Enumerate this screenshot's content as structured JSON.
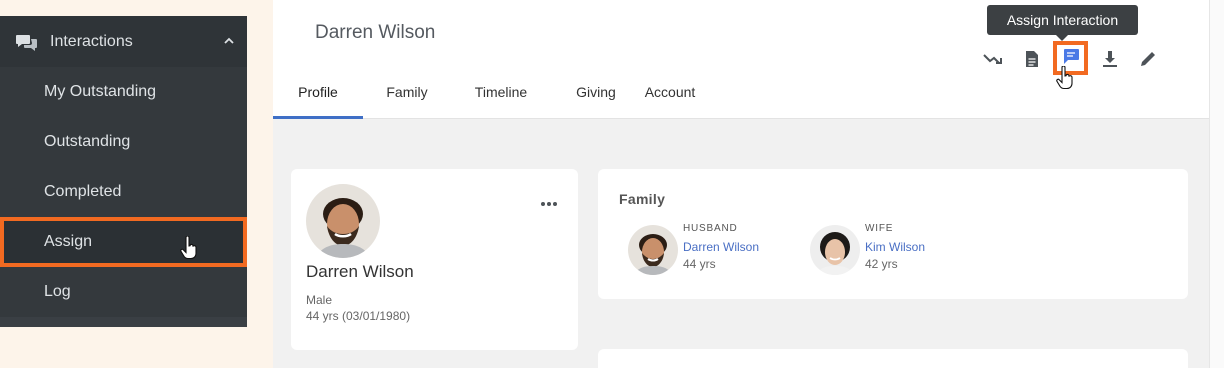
{
  "sidebar": {
    "header_label": "Interactions",
    "items": [
      {
        "label": "My Outstanding"
      },
      {
        "label": "Outstanding"
      },
      {
        "label": "Completed"
      },
      {
        "label": "Assign"
      },
      {
        "label": "Log"
      }
    ]
  },
  "header": {
    "person_name": "Darren Wilson"
  },
  "tabs": [
    {
      "label": "Profile",
      "active": true
    },
    {
      "label": "Family"
    },
    {
      "label": "Timeline"
    },
    {
      "label": "Giving"
    },
    {
      "label": "Account"
    }
  ],
  "actions": [
    {
      "icon": "share-arrow-icon"
    },
    {
      "icon": "document-icon"
    },
    {
      "icon": "message-icon"
    },
    {
      "icon": "download-icon"
    },
    {
      "icon": "pencil-icon"
    }
  ],
  "tooltip": {
    "text": "Assign Interaction"
  },
  "profile": {
    "name": "Darren Wilson",
    "gender": "Male",
    "age": "44 yrs (03/01/1980)"
  },
  "family": {
    "title": "Family",
    "members": [
      {
        "role": "HUSBAND",
        "name": "Darren Wilson",
        "age": "44 yrs"
      },
      {
        "role": "WIFE",
        "name": "Kim Wilson",
        "age": "42 yrs"
      }
    ]
  },
  "colors": {
    "highlight": "#f26a21",
    "accent": "#3f6fc6",
    "sidebar_bg": "#3a3f44"
  }
}
